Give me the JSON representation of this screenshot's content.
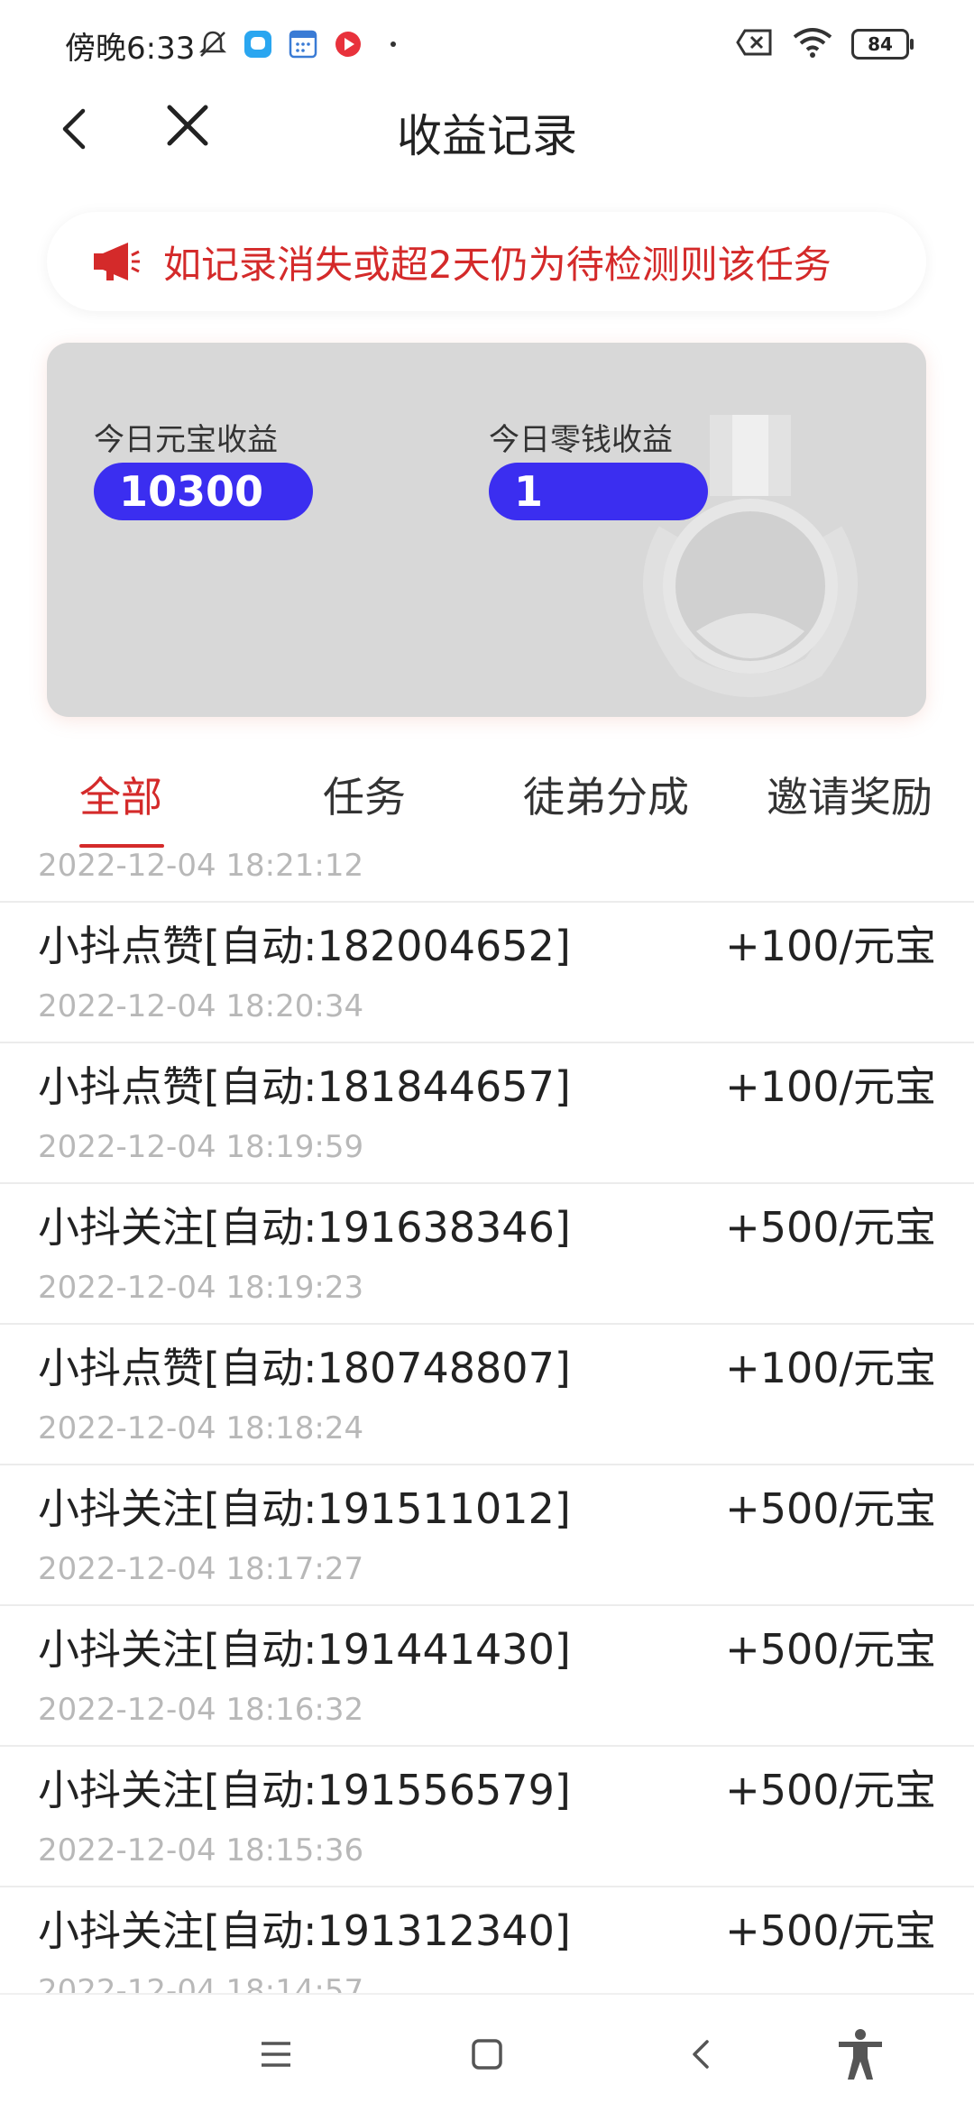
{
  "status_bar": {
    "time": "傍晚6:33",
    "battery": "84"
  },
  "header": {
    "title": "收益记录"
  },
  "notice": {
    "text": "如记录消失或超2天仍为待检测则该任务"
  },
  "earnings": {
    "yuanbao_label": "今日元宝收益",
    "yuanbao_value": "10300",
    "change_label": "今日零钱收益",
    "change_value": "1"
  },
  "tabs": [
    "全部",
    "任务",
    "徒弟分成",
    "邀请奖励"
  ],
  "records": [
    {
      "title": "",
      "amount": "",
      "time": "2022-12-04 18:21:12"
    },
    {
      "title": "小抖点赞[自动:182004652]",
      "amount": "+100/元宝",
      "time": "2022-12-04 18:20:34"
    },
    {
      "title": "小抖点赞[自动:181844657]",
      "amount": "+100/元宝",
      "time": "2022-12-04 18:19:59"
    },
    {
      "title": "小抖关注[自动:191638346]",
      "amount": "+500/元宝",
      "time": "2022-12-04 18:19:23"
    },
    {
      "title": "小抖点赞[自动:180748807]",
      "amount": "+100/元宝",
      "time": "2022-12-04 18:18:24"
    },
    {
      "title": "小抖关注[自动:191511012]",
      "amount": "+500/元宝",
      "time": "2022-12-04 18:17:27"
    },
    {
      "title": "小抖关注[自动:191441430]",
      "amount": "+500/元宝",
      "time": "2022-12-04 18:16:32"
    },
    {
      "title": "小抖关注[自动:191556579]",
      "amount": "+500/元宝",
      "time": "2022-12-04 18:15:36"
    },
    {
      "title": "小抖关注[自动:191312340]",
      "amount": "+500/元宝",
      "time": "2022-12-04 18:14:57"
    }
  ],
  "colors": {
    "accent": "#d42a2a",
    "badge": "#3b2ef0",
    "card_bg": "#d8d8d8",
    "muted": "#b8b8b8"
  },
  "icons": {
    "status": [
      "silent-bell-icon",
      "chat-app-icon",
      "calendar-app-icon",
      "video-app-icon",
      "dot-icon",
      "sim-x-icon",
      "wifi-icon",
      "battery-icon"
    ],
    "nav": [
      "back-arrow-icon",
      "close-icon"
    ],
    "notice": "megaphone-icon",
    "card": "medal-icon",
    "system": [
      "menu-icon",
      "home-icon",
      "back-icon",
      "accessibility-icon"
    ]
  }
}
